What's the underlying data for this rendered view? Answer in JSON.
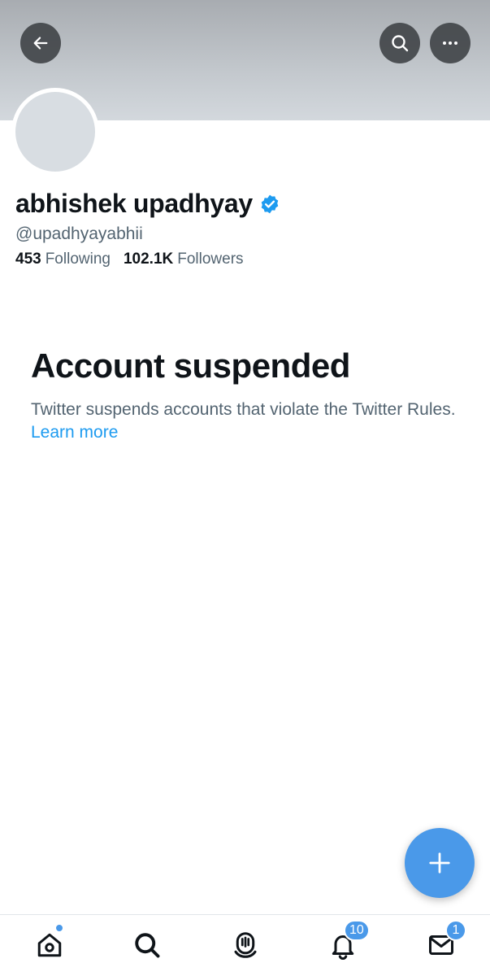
{
  "profile": {
    "display_name": "abhishek upadhyay",
    "handle": "@upadhyayabhii",
    "verified": true,
    "following_count": "453",
    "following_label": "Following",
    "followers_count": "102.1K",
    "followers_label": "Followers"
  },
  "suspension": {
    "title": "Account suspended",
    "message": "Twitter suspends accounts that violate the Twitter Rules.",
    "link_text": "Learn more"
  },
  "nav": {
    "notifications_badge": "10",
    "messages_badge": "1"
  },
  "icons": {
    "back": "arrow-left-icon",
    "search": "search-icon",
    "more": "more-horizontal-icon",
    "verified": "verified-badge-icon",
    "compose": "plus-icon",
    "home": "home-icon",
    "explore": "search-icon",
    "spaces": "microphone-icon",
    "notifications": "bell-icon",
    "messages": "envelope-icon"
  },
  "colors": {
    "accent": "#1d9bf0",
    "fab": "#4a99e9",
    "secondary_text": "#536471",
    "primary_text": "#0f1419"
  }
}
